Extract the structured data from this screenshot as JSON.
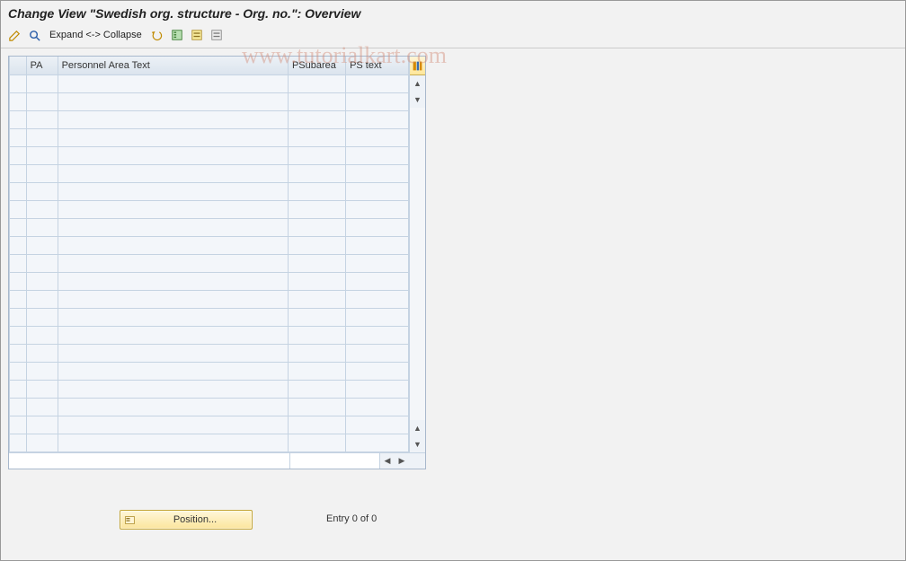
{
  "title": "Change View \"Swedish org. structure - Org. no.\": Overview",
  "toolbar": {
    "expand_collapse_label": "Expand <-> Collapse"
  },
  "table": {
    "columns": {
      "pa": "PA",
      "patext": "Personnel Area Text",
      "psubarea": "PSubarea",
      "pstext": "PS text"
    },
    "rows": 21
  },
  "footer": {
    "position_label": "Position...",
    "entry_text": "Entry 0 of 0"
  },
  "watermark": "www.tutorialkart.com"
}
